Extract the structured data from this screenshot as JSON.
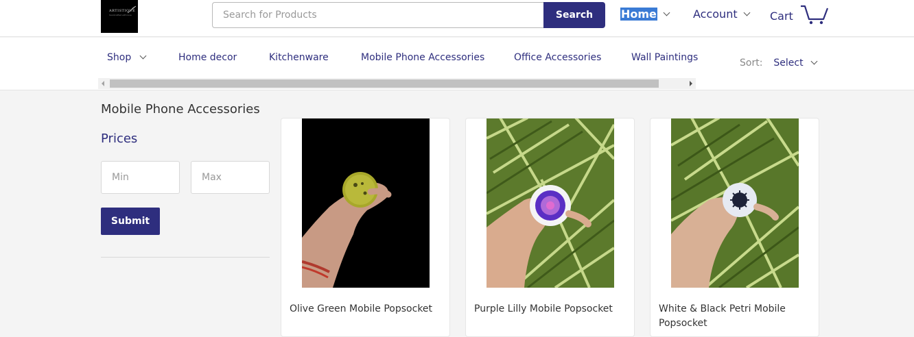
{
  "header": {
    "logo": {
      "text": "ARTISTIQUE",
      "sub": "handcrafted with love"
    },
    "search": {
      "placeholder": "Search for Products",
      "value": "",
      "button_label": "Search"
    },
    "nav": {
      "home": "Home",
      "account": "Account",
      "cart": "Cart"
    }
  },
  "categories": [
    "Shop",
    "Home decor",
    "Kitchenware",
    "Mobile Phone Accessories",
    "Office Accessories",
    "Wall Paintings"
  ],
  "sort": {
    "label": "Sort:",
    "value": "Select"
  },
  "sidebar": {
    "page_title": "Mobile Phone Accessories",
    "prices_title": "Prices",
    "min_placeholder": "Min",
    "max_placeholder": "Max",
    "submit_label": "Submit"
  },
  "products": [
    {
      "name": "Olive Green Mobile Popsocket"
    },
    {
      "name": "Purple Lilly Mobile Popsocket"
    },
    {
      "name": "White & Black Petri Mobile Popsocket"
    }
  ],
  "colors": {
    "brand": "#2e2e7e",
    "background": "#f4f4f4",
    "highlight": "#3a7bd5"
  }
}
